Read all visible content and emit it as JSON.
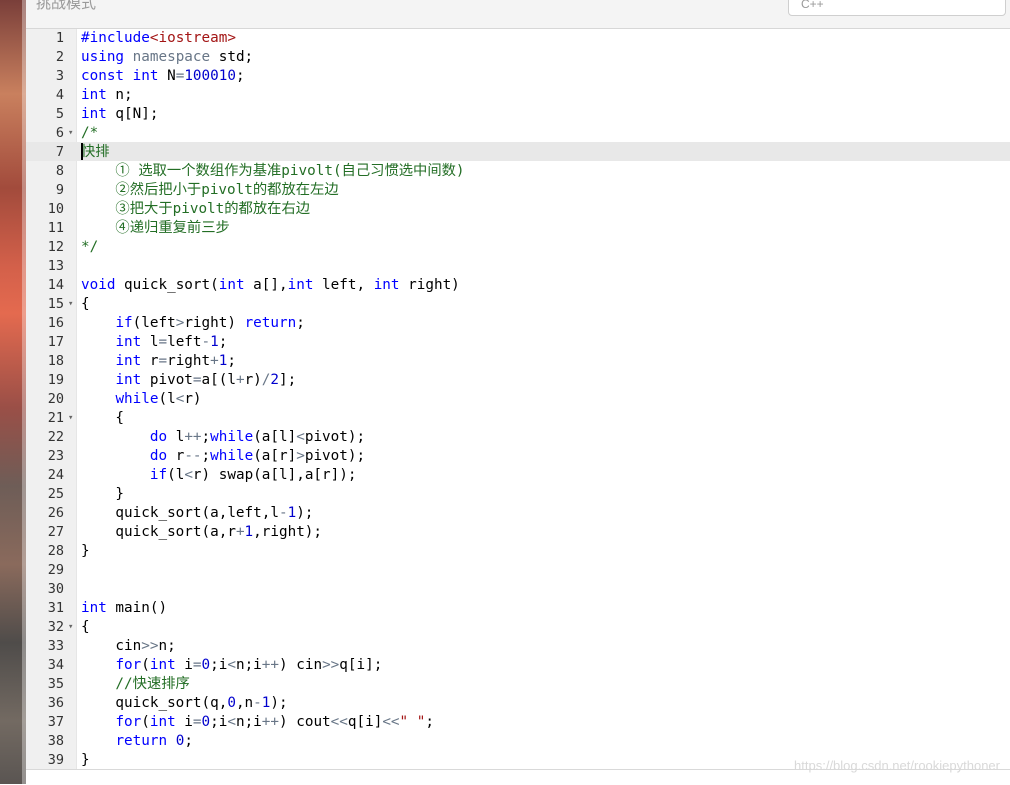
{
  "header": {
    "mode_label": "挑战模式",
    "lang_select_value": "C++"
  },
  "editor": {
    "lines": [
      {
        "n": "1",
        "fold": "",
        "segs": [
          [
            "pp",
            "#include"
          ],
          [
            "inc",
            "<iostream>"
          ]
        ]
      },
      {
        "n": "2",
        "fold": "",
        "segs": [
          [
            "kw",
            "using"
          ],
          [
            "",
            " "
          ],
          [
            "ns",
            "namespace"
          ],
          [
            "",
            " std;"
          ]
        ]
      },
      {
        "n": "3",
        "fold": "",
        "segs": [
          [
            "kw",
            "const"
          ],
          [
            "",
            " "
          ],
          [
            "ty",
            "int"
          ],
          [
            "",
            " N"
          ],
          [
            "op",
            "="
          ],
          [
            "num",
            "100010"
          ],
          [
            "",
            ";"
          ]
        ]
      },
      {
        "n": "4",
        "fold": "",
        "segs": [
          [
            "ty",
            "int"
          ],
          [
            "",
            " n;"
          ]
        ]
      },
      {
        "n": "5",
        "fold": "",
        "segs": [
          [
            "ty",
            "int"
          ],
          [
            "",
            " q[N];"
          ]
        ]
      },
      {
        "n": "6",
        "fold": "▾",
        "segs": [
          [
            "cm",
            "/*"
          ]
        ]
      },
      {
        "n": "7",
        "fold": "",
        "segs": [
          [
            "cm",
            "快排"
          ]
        ]
      },
      {
        "n": "8",
        "fold": "",
        "segs": [
          [
            "cm",
            "    ① 选取一个数组作为基准pivolt(自己习惯选中间数)"
          ]
        ]
      },
      {
        "n": "9",
        "fold": "",
        "segs": [
          [
            "cm",
            "    ②然后把小于pivolt的都放在左边"
          ]
        ]
      },
      {
        "n": "10",
        "fold": "",
        "segs": [
          [
            "cm",
            "    ③把大于pivolt的都放在右边"
          ]
        ]
      },
      {
        "n": "11",
        "fold": "",
        "segs": [
          [
            "cm",
            "    ④递归重复前三步"
          ]
        ]
      },
      {
        "n": "12",
        "fold": "",
        "segs": [
          [
            "cm",
            "*/"
          ]
        ]
      },
      {
        "n": "13",
        "fold": "",
        "segs": []
      },
      {
        "n": "14",
        "fold": "",
        "segs": [
          [
            "ty",
            "void"
          ],
          [
            "",
            " quick_sort("
          ],
          [
            "ty",
            "int"
          ],
          [
            "",
            " a[],"
          ],
          [
            "ty",
            "int"
          ],
          [
            "",
            " left, "
          ],
          [
            "ty",
            "int"
          ],
          [
            "",
            " right)"
          ]
        ]
      },
      {
        "n": "15",
        "fold": "▾",
        "segs": [
          [
            "",
            "{"
          ]
        ]
      },
      {
        "n": "16",
        "fold": "",
        "segs": [
          [
            "",
            "    "
          ],
          [
            "kw",
            "if"
          ],
          [
            "",
            "(left"
          ],
          [
            "op",
            ">"
          ],
          [
            "",
            "right) "
          ],
          [
            "kw",
            "return"
          ],
          [
            "",
            ";"
          ]
        ]
      },
      {
        "n": "17",
        "fold": "",
        "segs": [
          [
            "",
            "    "
          ],
          [
            "ty",
            "int"
          ],
          [
            "",
            " l"
          ],
          [
            "op",
            "="
          ],
          [
            "",
            "left"
          ],
          [
            "op",
            "-"
          ],
          [
            "num",
            "1"
          ],
          [
            "",
            ";"
          ]
        ]
      },
      {
        "n": "18",
        "fold": "",
        "segs": [
          [
            "",
            "    "
          ],
          [
            "ty",
            "int"
          ],
          [
            "",
            " r"
          ],
          [
            "op",
            "="
          ],
          [
            "",
            "right"
          ],
          [
            "op",
            "+"
          ],
          [
            "num",
            "1"
          ],
          [
            "",
            ";"
          ]
        ]
      },
      {
        "n": "19",
        "fold": "",
        "segs": [
          [
            "",
            "    "
          ],
          [
            "ty",
            "int"
          ],
          [
            "",
            " pivot"
          ],
          [
            "op",
            "="
          ],
          [
            "",
            "a[(l"
          ],
          [
            "op",
            "+"
          ],
          [
            "",
            "r)"
          ],
          [
            "op",
            "/"
          ],
          [
            "num",
            "2"
          ],
          [
            "",
            "];"
          ]
        ]
      },
      {
        "n": "20",
        "fold": "",
        "segs": [
          [
            "",
            "    "
          ],
          [
            "kw",
            "while"
          ],
          [
            "",
            "(l"
          ],
          [
            "op",
            "<"
          ],
          [
            "",
            "r)"
          ]
        ]
      },
      {
        "n": "21",
        "fold": "▾",
        "segs": [
          [
            "",
            "    {"
          ]
        ]
      },
      {
        "n": "22",
        "fold": "",
        "segs": [
          [
            "",
            "        "
          ],
          [
            "kw",
            "do"
          ],
          [
            "",
            " l"
          ],
          [
            "op",
            "++"
          ],
          [
            "",
            ";"
          ],
          [
            "kw",
            "while"
          ],
          [
            "",
            "(a[l]"
          ],
          [
            "op",
            "<"
          ],
          [
            "",
            "pivot);"
          ]
        ]
      },
      {
        "n": "23",
        "fold": "",
        "segs": [
          [
            "",
            "        "
          ],
          [
            "kw",
            "do"
          ],
          [
            "",
            " r"
          ],
          [
            "op",
            "--"
          ],
          [
            "",
            ";"
          ],
          [
            "kw",
            "while"
          ],
          [
            "",
            "(a[r]"
          ],
          [
            "op",
            ">"
          ],
          [
            "",
            "pivot);"
          ]
        ]
      },
      {
        "n": "24",
        "fold": "",
        "segs": [
          [
            "",
            "        "
          ],
          [
            "kw",
            "if"
          ],
          [
            "",
            "(l"
          ],
          [
            "op",
            "<"
          ],
          [
            "",
            "r) swap(a[l],a[r]);"
          ]
        ]
      },
      {
        "n": "25",
        "fold": "",
        "segs": [
          [
            "",
            "    }"
          ]
        ]
      },
      {
        "n": "26",
        "fold": "",
        "segs": [
          [
            "",
            "    quick_sort(a,left,l"
          ],
          [
            "op",
            "-"
          ],
          [
            "num",
            "1"
          ],
          [
            "",
            ");"
          ]
        ]
      },
      {
        "n": "27",
        "fold": "",
        "segs": [
          [
            "",
            "    quick_sort(a,r"
          ],
          [
            "op",
            "+"
          ],
          [
            "num",
            "1"
          ],
          [
            "",
            ",right);"
          ]
        ]
      },
      {
        "n": "28",
        "fold": "",
        "segs": [
          [
            "",
            "}"
          ]
        ]
      },
      {
        "n": "29",
        "fold": "",
        "segs": []
      },
      {
        "n": "30",
        "fold": "",
        "segs": []
      },
      {
        "n": "31",
        "fold": "",
        "segs": [
          [
            "ty",
            "int"
          ],
          [
            "",
            " main()"
          ]
        ]
      },
      {
        "n": "32",
        "fold": "▾",
        "segs": [
          [
            "",
            "{"
          ]
        ]
      },
      {
        "n": "33",
        "fold": "",
        "segs": [
          [
            "",
            "    cin"
          ],
          [
            "op",
            ">>"
          ],
          [
            "",
            "n;"
          ]
        ]
      },
      {
        "n": "34",
        "fold": "",
        "segs": [
          [
            "",
            "    "
          ],
          [
            "kw",
            "for"
          ],
          [
            "",
            "("
          ],
          [
            "ty",
            "int"
          ],
          [
            "",
            " i"
          ],
          [
            "op",
            "="
          ],
          [
            "num",
            "0"
          ],
          [
            "",
            ";i"
          ],
          [
            "op",
            "<"
          ],
          [
            "",
            "n;i"
          ],
          [
            "op",
            "++"
          ],
          [
            "",
            ") cin"
          ],
          [
            "op",
            ">>"
          ],
          [
            "",
            "q[i];"
          ]
        ]
      },
      {
        "n": "35",
        "fold": "",
        "segs": [
          [
            "cm",
            "    //快速排序"
          ]
        ]
      },
      {
        "n": "36",
        "fold": "",
        "segs": [
          [
            "",
            "    quick_sort(q,"
          ],
          [
            "num",
            "0"
          ],
          [
            "",
            ",n"
          ],
          [
            "op",
            "-"
          ],
          [
            "num",
            "1"
          ],
          [
            "",
            ");"
          ]
        ]
      },
      {
        "n": "37",
        "fold": "",
        "segs": [
          [
            "",
            "    "
          ],
          [
            "kw",
            "for"
          ],
          [
            "",
            "("
          ],
          [
            "ty",
            "int"
          ],
          [
            "",
            " i"
          ],
          [
            "op",
            "="
          ],
          [
            "num",
            "0"
          ],
          [
            "",
            ";i"
          ],
          [
            "op",
            "<"
          ],
          [
            "",
            "n;i"
          ],
          [
            "op",
            "++"
          ],
          [
            "",
            ") cout"
          ],
          [
            "op",
            "<<"
          ],
          [
            "",
            "q[i]"
          ],
          [
            "op",
            "<<"
          ],
          [
            "str",
            "\" \""
          ],
          [
            "",
            ";"
          ]
        ]
      },
      {
        "n": "38",
        "fold": "",
        "segs": [
          [
            "",
            "    "
          ],
          [
            "kw",
            "return"
          ],
          [
            "",
            " "
          ],
          [
            "num",
            "0"
          ],
          [
            "",
            ";"
          ]
        ]
      },
      {
        "n": "39",
        "fold": "",
        "segs": [
          [
            "",
            "}"
          ]
        ]
      }
    ]
  },
  "watermark": "https://blog.csdn.net/rookiepythoner"
}
